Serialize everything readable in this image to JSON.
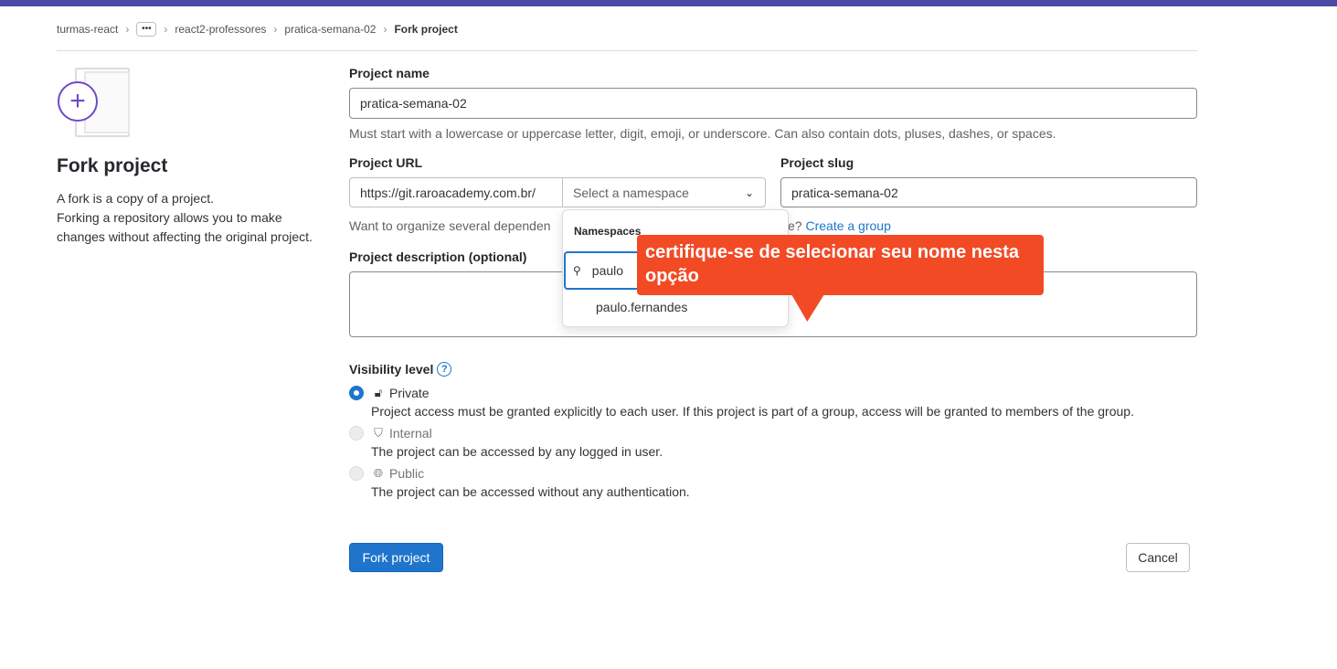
{
  "breadcrumb": {
    "items": [
      "turmas-react",
      "react2-professores",
      "pratica-semana-02",
      "Fork project"
    ],
    "ellipsis": "•••"
  },
  "left": {
    "title": "Fork project",
    "description_line1": "A fork is a copy of a project.",
    "description_rest": "Forking a repository allows you to make changes without affecting the original project."
  },
  "form": {
    "project_name_label": "Project name",
    "project_name_value": "pratica-semana-02",
    "project_name_help": "Must start with a lowercase or uppercase letter, digit, emoji, or underscore. Can also contain dots, pluses, dashes, or spaces.",
    "project_url_label": "Project URL",
    "project_url_prefix": "https://git.raroacademy.com.br/",
    "namespace_placeholder": "Select a namespace",
    "project_slug_label": "Project slug",
    "project_slug_value": "pratica-semana-02",
    "organize_help_visible": "Want to organize several dependen",
    "organize_help_suffix": "e?",
    "create_group_link": "Create a group",
    "description_label": "Project description (optional)"
  },
  "dropdown": {
    "header": "Namespaces",
    "search_value": "paulo",
    "items": [
      "paulo.fernandes"
    ]
  },
  "callout": {
    "text": "certifique-se de selecionar seu nome nesta opção",
    "color": "#f24a25"
  },
  "visibility": {
    "label": "Visibility level",
    "help_glyph": "?",
    "options": [
      {
        "name": "Private",
        "icon": "lock-icon",
        "description": "Project access must be granted explicitly to each user. If this project is part of a group, access will be granted to members of the group.",
        "selected": true,
        "disabled": false
      },
      {
        "name": "Internal",
        "icon": "shield-icon",
        "description": "The project can be accessed by any logged in user.",
        "selected": false,
        "disabled": true
      },
      {
        "name": "Public",
        "icon": "globe-icon",
        "description": "The project can be accessed without any authentication.",
        "selected": false,
        "disabled": true
      }
    ]
  },
  "buttons": {
    "fork": "Fork project",
    "cancel": "Cancel"
  },
  "colors": {
    "topbar": "#4b4ba3",
    "primary": "#1f75cb",
    "fork_illustration": "#6e49cb"
  }
}
